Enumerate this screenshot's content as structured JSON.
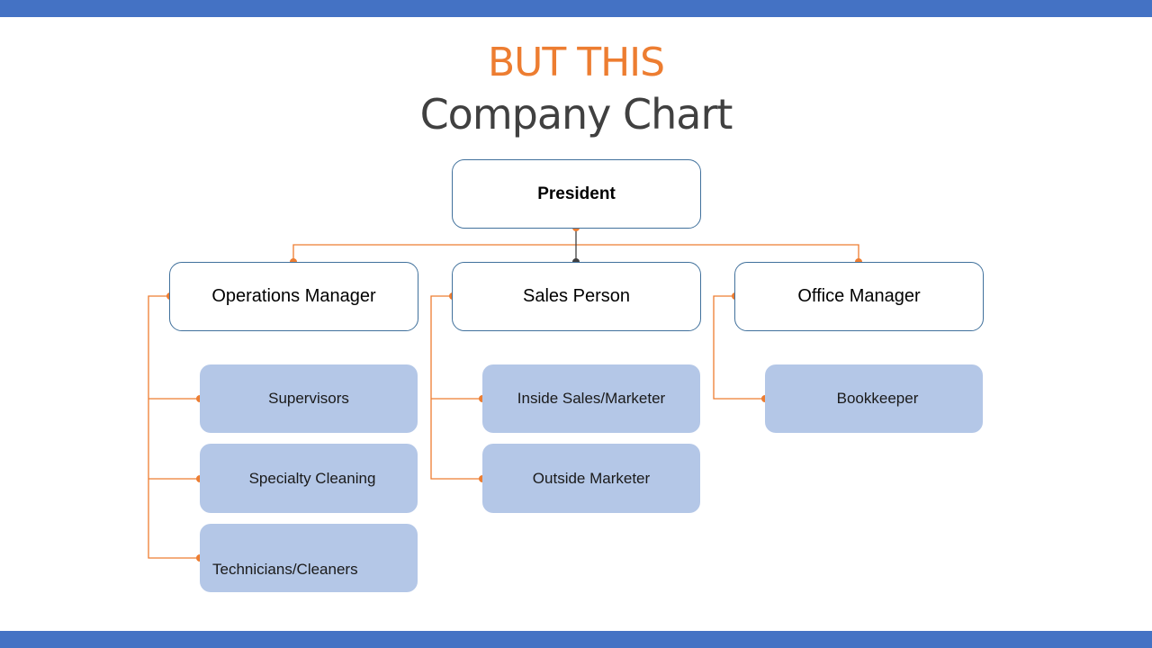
{
  "slide": {
    "title_accent": "BUT THIS",
    "title_main": "Company Chart",
    "colors": {
      "accent_bar": "#4472c4",
      "title_accent": "#ed7d31",
      "title_main": "#404040",
      "connector": "#ed7d31",
      "connector_center": "#404040",
      "box_border": "#41719c",
      "sub_box_fill": "#b4c7e7"
    }
  },
  "org": {
    "top": {
      "label": "President"
    },
    "managers": [
      {
        "label": "Operations Manager",
        "reports": [
          "Supervisors",
          "Specialty Cleaning",
          "Technicians/Cleaners"
        ]
      },
      {
        "label": "Sales Person",
        "reports": [
          "Inside Sales/Marketer",
          "Outside Marketer"
        ]
      },
      {
        "label": "Office Manager",
        "reports": [
          "Bookkeeper"
        ]
      }
    ]
  }
}
